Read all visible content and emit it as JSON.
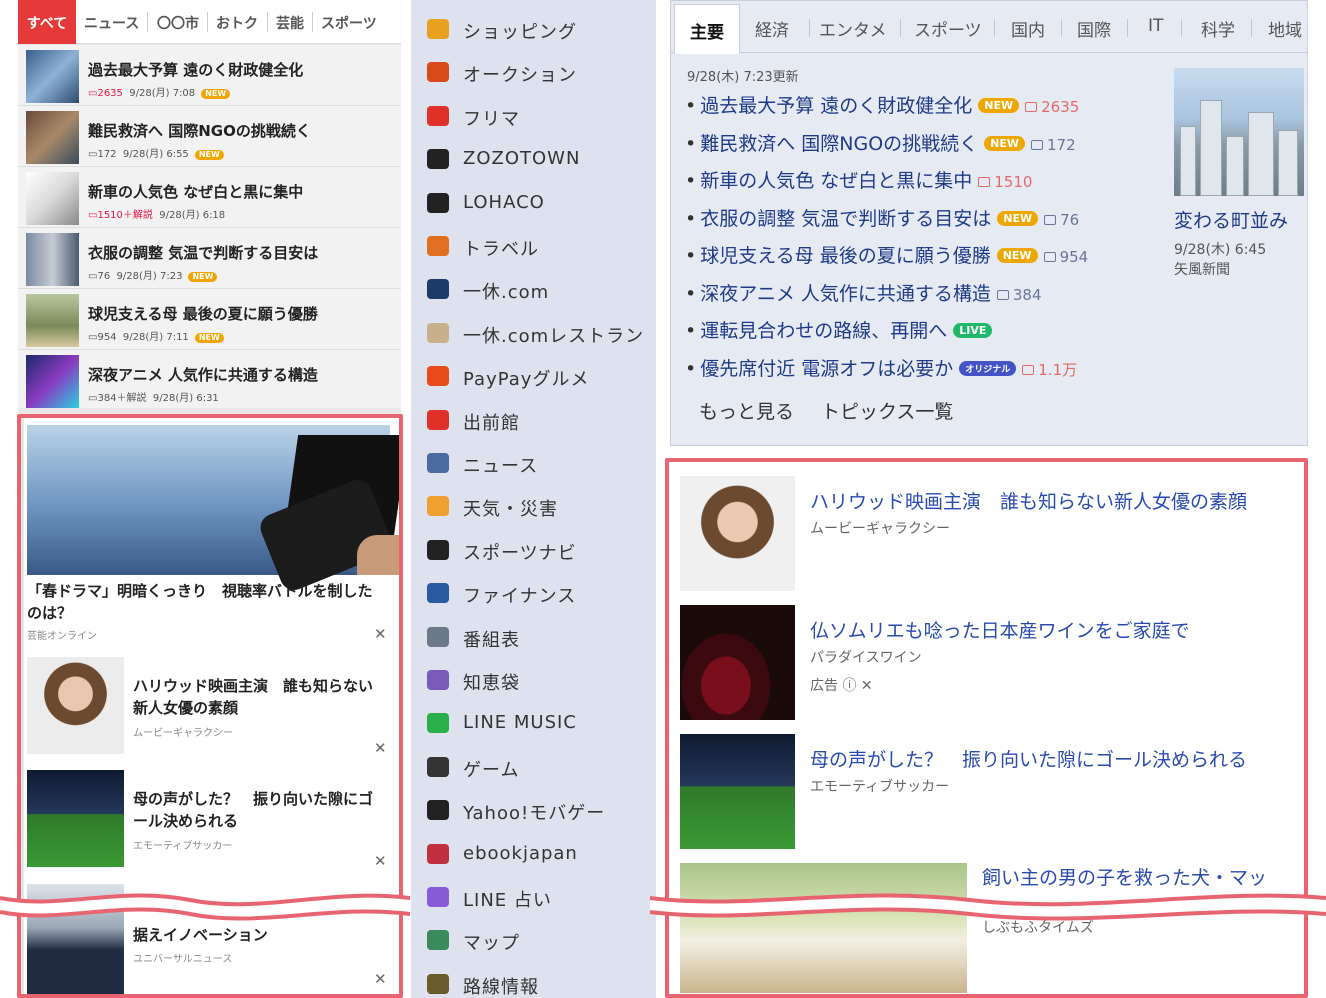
{
  "mobile": {
    "tabs": [
      "すべて",
      "ニュース",
      "〇〇市",
      "おトク",
      "芸能",
      "スポーツ"
    ],
    "news": [
      {
        "title": "過去最大予算 遠のく財政健全化",
        "comments": "2635",
        "time": "9/28(月) 7:08",
        "badge": "NEW"
      },
      {
        "title": "難民救済へ 国際NGOの挑戦続く",
        "comments": "172",
        "time": "9/28(月) 6:55",
        "badge": "NEW"
      },
      {
        "title": "新車の人気色 なぜ白と黒に集中",
        "comments": "1510＋解説",
        "time": "9/28(月) 6:18",
        "badge": ""
      },
      {
        "title": "衣服の調整 気温で判断する目安は",
        "comments": "76",
        "time": "9/28(月) 7:23",
        "badge": "NEW"
      },
      {
        "title": "球児支える母 最後の夏に願う優勝",
        "comments": "954",
        "time": "9/28(月) 7:11",
        "badge": "NEW"
      },
      {
        "title": "深夜アニメ 人気作に共通する構造",
        "comments": "384＋解説",
        "time": "9/28(月) 6:31",
        "badge": ""
      }
    ],
    "ads": {
      "hero_title": "「春ドラマ」明暗くっきり　視聴率バトルを制したのは？",
      "hero_source": "芸能オンライン",
      "items": [
        {
          "title": "ハリウッド映画主演　誰も知らない新人女優の素顔",
          "source": "ムービーギャラクシー"
        },
        {
          "title": "母の声がした？　振り向いた隙にゴール決められる",
          "source": "エモーティブサッカー"
        },
        {
          "title": "据えイノベーション",
          "source": "ユニバーサルニュース"
        }
      ],
      "close": "✕"
    }
  },
  "services": [
    "ショッピング",
    "オークション",
    "フリマ",
    "ZOZOTOWN",
    "LOHACO",
    "トラベル",
    "一休.com",
    "一休.comレストラン",
    "PayPayグルメ",
    "出前館",
    "ニュース",
    "天気・災害",
    "スポーツナビ",
    "ファイナンス",
    "番組表",
    "知恵袋",
    "LINE MUSIC",
    "ゲーム",
    "Yahoo!モバゲー",
    "ebookjapan",
    "LINE 占い",
    "マップ",
    "路線情報"
  ],
  "topics": {
    "tabs": [
      "主要",
      "経済",
      "エンタメ",
      "スポーツ",
      "国内",
      "国際",
      "IT",
      "科学",
      "地域"
    ],
    "updated": "9/28(木) 7:23更新",
    "items": [
      {
        "title": "過去最大予算 遠のく財政健全化",
        "badge": "NEW",
        "comments": "2635",
        "hot": true
      },
      {
        "title": "難民救済へ 国際NGOの挑戦続く",
        "badge": "NEW",
        "comments": "172",
        "hot": false
      },
      {
        "title": "新車の人気色 なぜ白と黒に集中",
        "badge": "",
        "comments": "1510",
        "hot": true
      },
      {
        "title": "衣服の調整 気温で判断する目安は",
        "badge": "NEW",
        "comments": "76",
        "hot": false
      },
      {
        "title": "球児支える母 最後の夏に願う優勝",
        "badge": "NEW",
        "comments": "954",
        "hot": false
      },
      {
        "title": "深夜アニメ 人気作に共通する構造",
        "badge": "",
        "comments": "384",
        "hot": false
      },
      {
        "title": "運転見合わせの路線、再開へ",
        "badge": "LIVE",
        "comments": "",
        "hot": false
      },
      {
        "title": "優先席付近 電源オフは必要か",
        "badge": "オリジナル",
        "comments": "1.1万",
        "hot": true
      }
    ],
    "more": "もっと見る",
    "list": "トピックス一覧",
    "photo_caption": "変わる町並み",
    "photo_date": "9/28(木) 6:45",
    "photo_source": "矢風新聞"
  },
  "right_ads": [
    {
      "title": "ハリウッド映画主演　誰も知らない新人女優の素顔",
      "source": "ムービーギャラクシー"
    },
    {
      "title": "仏ソムリエも唸った日本産ワインをご家庭で",
      "source": "パラダイスワイン",
      "ad_label": "広告"
    },
    {
      "title": "母の声がした？　振り向いた隙にゴール決められる",
      "source": "エモーティブサッカー"
    },
    {
      "title": "飼い主の男の子を救った犬・マッ",
      "source": "しぶもふタイムズ"
    }
  ],
  "colors": {
    "accent": "#e63a3a",
    "highlight": "#e86470",
    "link": "#1f3b88",
    "new_badge": "#eda700",
    "live_badge": "#1fb86a"
  }
}
